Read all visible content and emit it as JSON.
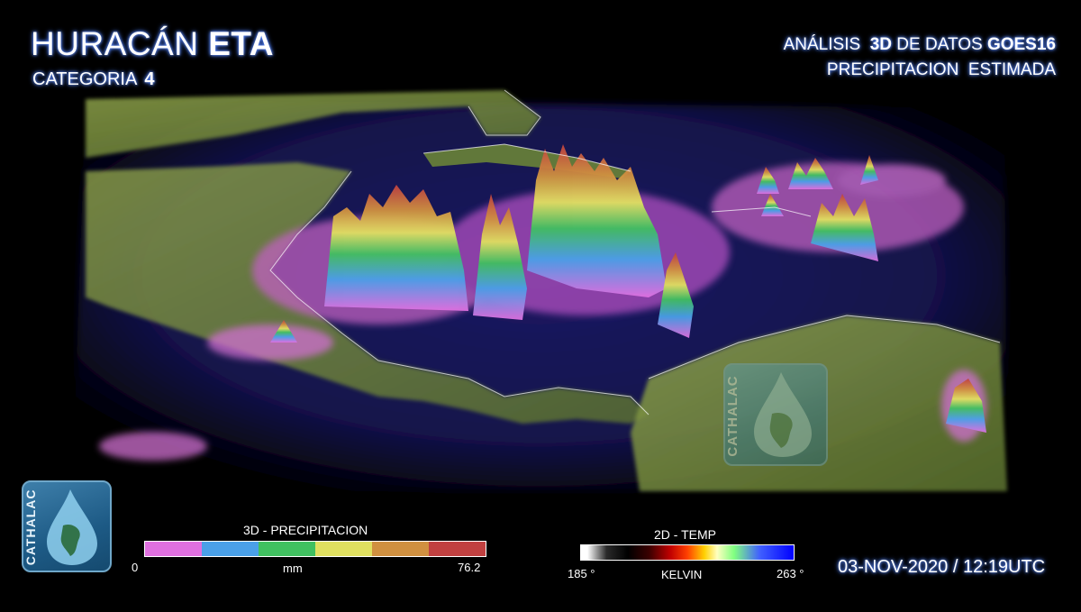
{
  "title": {
    "prefix": "HURACÁN",
    "name": "ETA"
  },
  "subtitle": {
    "label": "CATEGORIA",
    "value": "4"
  },
  "analysis": {
    "line1_prefix": "ANÁLISIS",
    "line1_bold1": "3D",
    "line1_mid": "DE DATOS",
    "line1_bold2": "GOES16",
    "line2": "PRECIPITACION  ESTIMADA"
  },
  "logo": {
    "text": "CATHALAC",
    "watermark_text": "CATHALAC"
  },
  "precip_legend": {
    "title": "3D - PRECIPITACION",
    "min": "0",
    "unit": "mm",
    "max": "76.2",
    "colors": [
      "#e070e0",
      "#4aa0e8",
      "#40c060",
      "#e0e060",
      "#d09040",
      "#c04040"
    ]
  },
  "temp_legend": {
    "title": "2D - TEMP",
    "min": "185 °",
    "unit": "KELVIN",
    "max": "263 °"
  },
  "timestamp": "03-NOV-2020 / 12:19UTC",
  "colors": {
    "background": "#000000",
    "ocean": "#16154f",
    "land": "#7a8f3a",
    "title_glow": "#4a7cff"
  }
}
